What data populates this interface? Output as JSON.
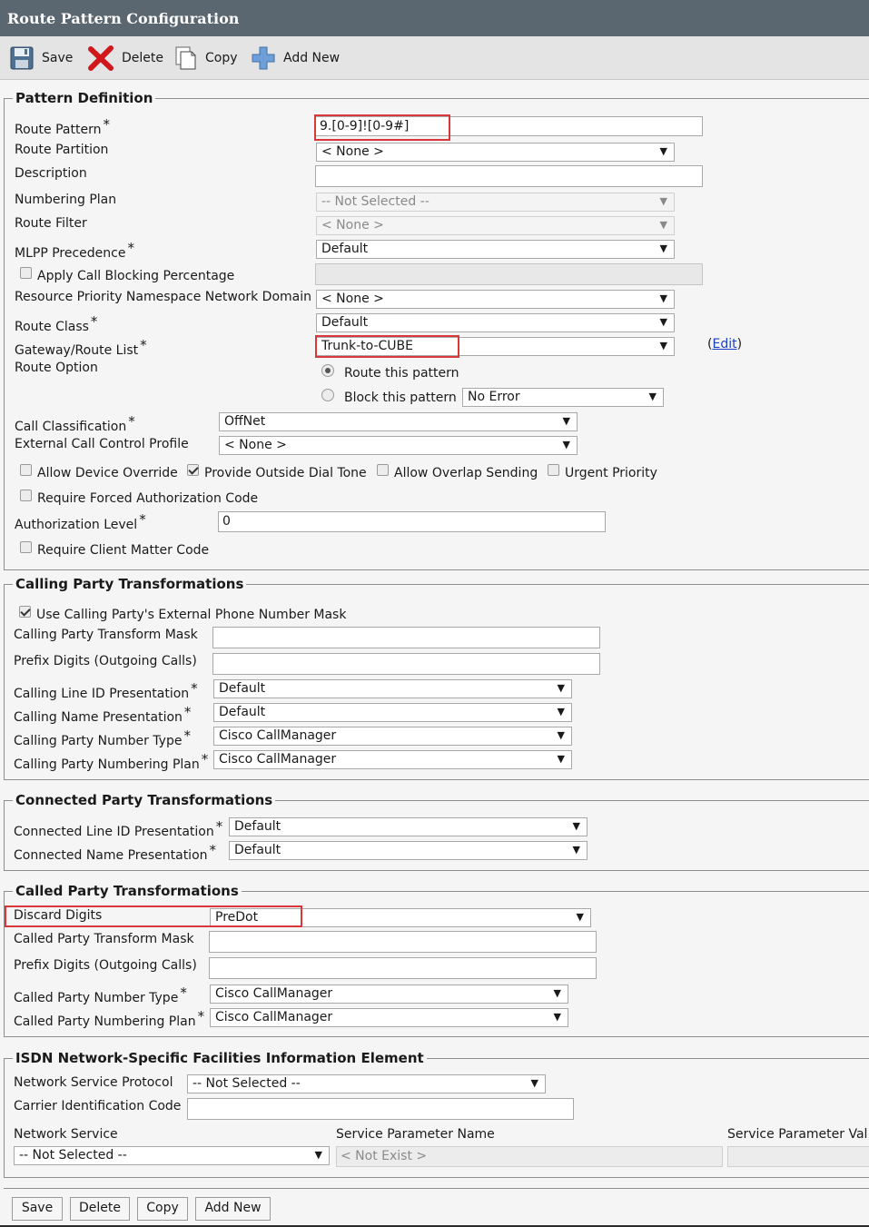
{
  "title": "Route Pattern Configuration",
  "toolbar": {
    "save": "Save",
    "delete": "Delete",
    "copy": "Copy",
    "add_new": "Add New"
  },
  "pattern_definition": {
    "legend": "Pattern Definition",
    "route_pattern": {
      "label": "Route Pattern",
      "value": "9.[0-9]![0-9#]"
    },
    "route_partition": {
      "label": "Route Partition",
      "value": "< None >"
    },
    "description": {
      "label": "Description",
      "value": ""
    },
    "numbering_plan": {
      "label": "Numbering Plan",
      "value": "-- Not Selected --"
    },
    "route_filter": {
      "label": "Route Filter",
      "value": "< None >"
    },
    "mlpp_precedence": {
      "label": "MLPP Precedence",
      "value": "Default"
    },
    "apply_call_blocking": {
      "label": "Apply Call Blocking Percentage",
      "checked": false
    },
    "resource_priority": {
      "label": "Resource Priority Namespace Network Domain",
      "value": "< None >"
    },
    "route_class": {
      "label": "Route Class",
      "value": "Default"
    },
    "gateway_route_list": {
      "label": "Gateway/Route List",
      "value": "Trunk-to-CUBE",
      "edit_open": "(",
      "edit_link": "Edit",
      "edit_close": ")"
    },
    "route_option": {
      "label": "Route Option",
      "route_this": "Route this pattern",
      "block_this": "Block this pattern",
      "block_reason": "No Error"
    },
    "call_classification": {
      "label": "Call Classification",
      "value": "OffNet"
    },
    "external_call_control": {
      "label": "External Call Control Profile",
      "value": "< None >"
    },
    "allow_device_override": {
      "label": "Allow Device Override",
      "checked": false
    },
    "provide_outside_dial_tone": {
      "label": "Provide Outside Dial Tone",
      "checked": true
    },
    "allow_overlap_sending": {
      "label": "Allow Overlap Sending",
      "checked": false
    },
    "urgent_priority": {
      "label": "Urgent Priority",
      "checked": false
    },
    "require_forced_auth": {
      "label": "Require Forced Authorization Code",
      "checked": false
    },
    "authorization_level": {
      "label": "Authorization Level",
      "value": "0"
    },
    "require_client_matter": {
      "label": "Require Client Matter Code",
      "checked": false
    }
  },
  "calling_party": {
    "legend": "Calling Party Transformations",
    "use_external_mask": {
      "label": "Use Calling Party's External Phone Number Mask",
      "checked": true
    },
    "transform_mask": {
      "label": "Calling Party Transform Mask",
      "value": ""
    },
    "prefix_digits": {
      "label": "Prefix Digits (Outgoing Calls)",
      "value": ""
    },
    "line_id_presentation": {
      "label": "Calling Line ID Presentation",
      "value": "Default"
    },
    "name_presentation": {
      "label": "Calling Name Presentation",
      "value": "Default"
    },
    "number_type": {
      "label": "Calling Party Number Type",
      "value": "Cisco CallManager"
    },
    "numbering_plan": {
      "label": "Calling Party Numbering Plan",
      "value": "Cisco CallManager"
    }
  },
  "connected_party": {
    "legend": "Connected Party Transformations",
    "line_id_presentation": {
      "label": "Connected Line ID Presentation",
      "value": "Default"
    },
    "name_presentation": {
      "label": "Connected Name Presentation",
      "value": "Default"
    }
  },
  "called_party": {
    "legend": "Called Party Transformations",
    "discard_digits": {
      "label": "Discard Digits",
      "value": "PreDot"
    },
    "transform_mask": {
      "label": "Called Party Transform Mask",
      "value": ""
    },
    "prefix_digits": {
      "label": "Prefix Digits (Outgoing Calls)",
      "value": ""
    },
    "number_type": {
      "label": "Called Party Number Type",
      "value": "Cisco CallManager"
    },
    "numbering_plan": {
      "label": "Called Party Numbering Plan",
      "value": "Cisco CallManager"
    }
  },
  "isdn": {
    "legend": "ISDN Network-Specific Facilities Information Element",
    "network_service_protocol": {
      "label": "Network Service Protocol",
      "value": "-- Not Selected --"
    },
    "carrier_id_code": {
      "label": "Carrier Identification Code",
      "value": ""
    },
    "network_service": {
      "label": "Network Service",
      "value": "-- Not Selected --"
    },
    "service_param_name": {
      "label": "Service Parameter Name",
      "value": "< Not Exist >"
    },
    "service_param_value": {
      "label": "Service Parameter Val",
      "value": ""
    }
  },
  "bottom_buttons": {
    "save": "Save",
    "delete": "Delete",
    "copy": "Copy",
    "add_new": "Add New"
  },
  "colors": {
    "title_bar": "#5b6770",
    "toolbar": "#e4e4e4",
    "highlight": "#d9383a",
    "link": "#1a3fc6"
  },
  "icons": [
    "save-icon",
    "delete-icon",
    "copy-icon",
    "add-icon"
  ]
}
